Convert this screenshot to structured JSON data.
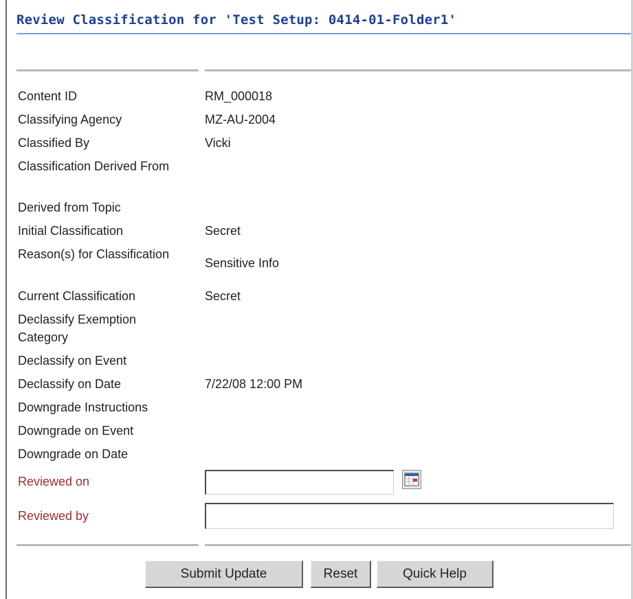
{
  "title": "Review Classification for 'Test Setup: 0414-01-Folder1'",
  "fields": [
    {
      "label": "Content ID",
      "value": "RM_000018"
    },
    {
      "label": "Classifying Agency",
      "value": "MZ-AU-2004"
    },
    {
      "label": "Classified By",
      "value": "Vicki"
    },
    {
      "label": "Classification Derived From",
      "value": ""
    },
    {
      "label": "Derived from Topic",
      "value": ""
    },
    {
      "label": "Initial Classification",
      "value": "Secret"
    },
    {
      "label": "Reason(s) for Classification",
      "value": "Sensitive Info"
    },
    {
      "label": "Current Classification",
      "value": "Secret"
    },
    {
      "label": "Declassify Exemption Category",
      "value": ""
    },
    {
      "label": "Declassify on Event",
      "value": ""
    },
    {
      "label": "Declassify on Date",
      "value": "7/22/08 12:00 PM"
    },
    {
      "label": "Downgrade Instructions",
      "value": ""
    },
    {
      "label": "Downgrade on Event",
      "value": ""
    },
    {
      "label": "Downgrade on Date",
      "value": ""
    }
  ],
  "reviewed_on": {
    "label": "Reviewed on",
    "value": ""
  },
  "reviewed_by": {
    "label": "Reviewed by",
    "value": ""
  },
  "buttons": {
    "submit": "Submit Update",
    "reset": "Reset",
    "help": "Quick Help"
  },
  "icons": {
    "calendar": "calendar-icon"
  },
  "colors": {
    "title": "#1f3f8f",
    "title_rule": "#6f9fd6",
    "required_label": "#9b2d2d",
    "button_face": "#d6d6d6"
  }
}
